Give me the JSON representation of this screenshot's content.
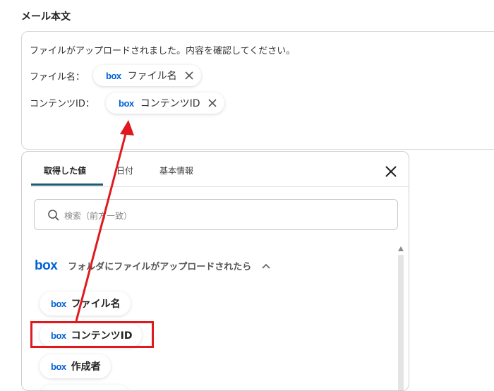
{
  "section_label": "メール本文",
  "editor": {
    "body_line": "ファイルがアップロードされました。内容を確認してください。",
    "rows": [
      {
        "label": "ファイル名：",
        "chip_logo": "box",
        "chip_text": "ファイル名"
      },
      {
        "label": "コンテンツID：",
        "chip_logo": "box",
        "chip_text": "コンテンツID"
      }
    ]
  },
  "panel": {
    "tabs": [
      {
        "label": "取得した値",
        "active": true
      },
      {
        "label": "日付",
        "active": false
      },
      {
        "label": "基本情報",
        "active": false
      }
    ],
    "search_placeholder": "検索（前方一致）",
    "group": {
      "logo": "box",
      "title": "フォルダにファイルがアップロードされたら",
      "expanded": true
    },
    "items": [
      {
        "logo": "box",
        "label": "ファイル名"
      },
      {
        "logo": "box",
        "label": "コンテンツID",
        "highlighted": true
      },
      {
        "logo": "box",
        "label": "作成者"
      }
    ]
  },
  "icons": {
    "close": "close-icon",
    "remove_chip": "x-icon",
    "search": "search-icon",
    "collapse": "chevron-up-icon",
    "scroll": "scroll-up-icon"
  },
  "colors": {
    "box_blue": "#0061d5",
    "tab_active_underline": "#1d5c75",
    "annotation_red": "#e0191f"
  }
}
